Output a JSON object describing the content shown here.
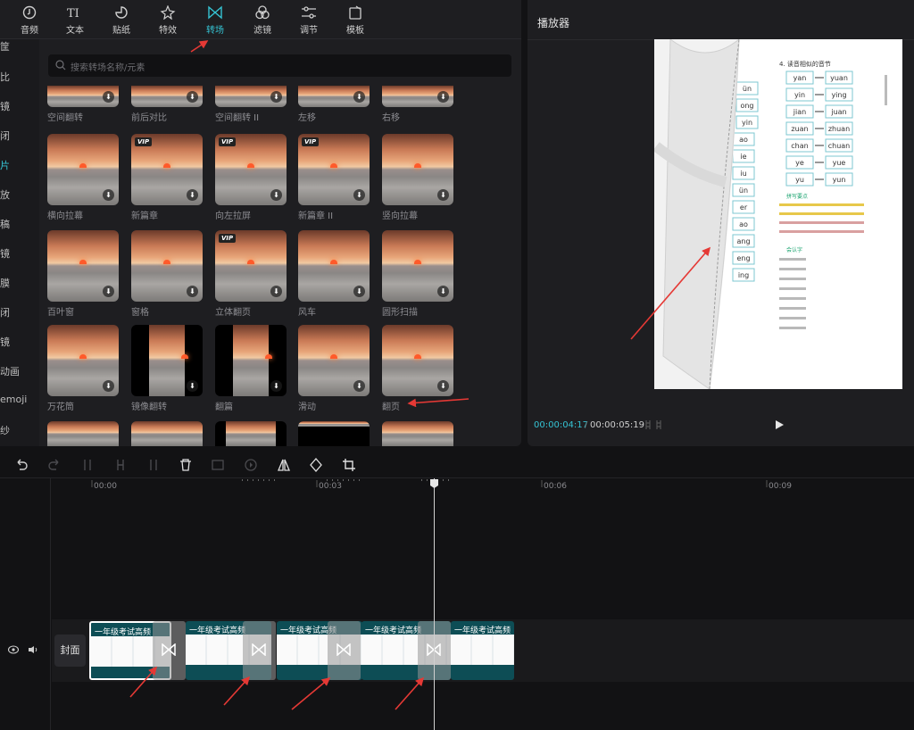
{
  "tabs": [
    {
      "label": "音频",
      "icon": "audio-icon"
    },
    {
      "label": "文本",
      "icon": "text-icon"
    },
    {
      "label": "贴纸",
      "icon": "sticker-icon"
    },
    {
      "label": "特效",
      "icon": "effects-icon"
    },
    {
      "label": "转场",
      "icon": "transition-icon",
      "active": true
    },
    {
      "label": "滤镜",
      "icon": "filter-icon"
    },
    {
      "label": "调节",
      "icon": "adjust-icon"
    },
    {
      "label": "模板",
      "icon": "template-icon"
    }
  ],
  "sidebar": {
    "items": [
      "筐",
      "比",
      "镜",
      "闭",
      "片",
      "放",
      "稿",
      "镜",
      "膜",
      "闭",
      "镜",
      "动画",
      "emoji",
      "纱"
    ],
    "active_index": 4
  },
  "search": {
    "placeholder": "搜索转场名称/元素"
  },
  "transitions_row0": [
    "空间翻转",
    "前后对比",
    "空间翻转 II",
    "左移",
    "右移"
  ],
  "transitions": [
    {
      "label": "横向拉幕",
      "vip": false
    },
    {
      "label": "新篇章",
      "vip": true
    },
    {
      "label": "向左拉屏",
      "vip": true
    },
    {
      "label": "新篇章 II",
      "vip": true
    },
    {
      "label": "竖向拉幕",
      "vip": false
    },
    {
      "label": "百叶窗",
      "vip": false
    },
    {
      "label": "窗格",
      "vip": false
    },
    {
      "label": "立体翻页",
      "vip": true
    },
    {
      "label": "风车",
      "vip": false
    },
    {
      "label": "圆形扫描",
      "vip": false
    },
    {
      "label": "万花筒",
      "vip": false
    },
    {
      "label": "镜像翻转",
      "vip": false
    },
    {
      "label": "翻篇",
      "vip": false
    },
    {
      "label": "滑动",
      "vip": false
    },
    {
      "label": "翻页",
      "vip": false
    }
  ],
  "vip_badge": "VIP",
  "player": {
    "title": "播放器",
    "current_time": "00:00:04:17",
    "separator": "/",
    "total_time": "00:00:05:19"
  },
  "worksheet": {
    "left_partial": [
      "ün",
      "ong",
      "yin",
      "ao",
      "ie",
      "iu",
      "ün",
      "er",
      "ao",
      "ang",
      "eng",
      "ing"
    ],
    "heading": "4. 读音相似的音节",
    "pairs": [
      [
        "yan",
        "yuan"
      ],
      [
        "yin",
        "ying"
      ],
      [
        "jian",
        "juan"
      ],
      [
        "zuan",
        "zhuan"
      ],
      [
        "chan",
        "chuan"
      ],
      [
        "ye",
        "yue"
      ],
      [
        "yu",
        "yun"
      ]
    ],
    "note_title": "拼写要点",
    "note_title2": "会认字"
  },
  "timeline": {
    "ticks": [
      "00:00",
      "00:03",
      "00:06",
      "00:09"
    ],
    "cover_label": "封面",
    "clip_title": "一年级考试高频"
  },
  "colors": {
    "accent": "#35c3d3",
    "clip": "#0d4d55",
    "annotation": "#e53935"
  }
}
